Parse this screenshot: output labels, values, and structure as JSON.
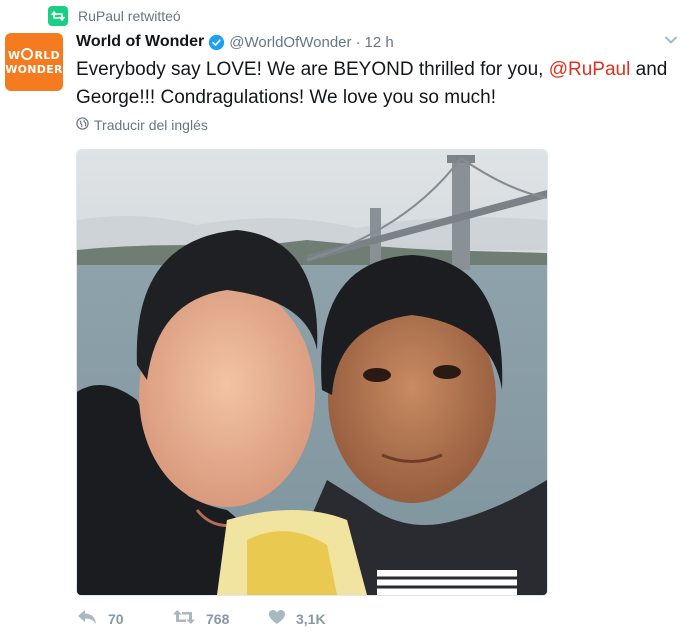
{
  "retweet": {
    "label": "RuPaul retwitteó",
    "icon": "retweet-icon",
    "color": "#19cf86"
  },
  "author": {
    "avatar_lines": [
      "W",
      "RLD",
      "WONDER"
    ],
    "avatar_color": "#f47b20",
    "name": "World of Wonder",
    "handle": "@WorldOfWonder",
    "separator": "·",
    "time": "12 h"
  },
  "tweet": {
    "text_before": "Everybody say LOVE! We are BEYOND thrilled for you, ",
    "mention": "@RuPaul",
    "text_after": " and George!!! Condragulations! We love you so much!",
    "mention_color": "#e0301e"
  },
  "translate": {
    "label": "Traducir del inglés",
    "icon": "globe-icon"
  },
  "actions": {
    "reply_count": "70",
    "retweet_count": "768",
    "like_count": "3,1K"
  }
}
